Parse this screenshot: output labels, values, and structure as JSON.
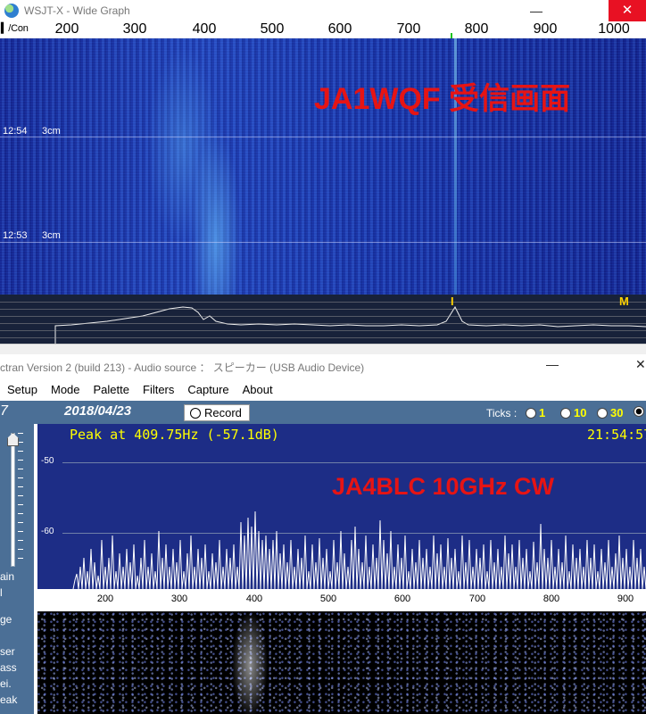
{
  "wsjt": {
    "title": "WSJT-X - Wide Graph",
    "control_label": "Con",
    "scale_ticks": [
      "200",
      "300",
      "400",
      "500",
      "600",
      "700",
      "800",
      "900",
      "1000"
    ],
    "time_stamps": [
      {
        "time": "12:54",
        "value": "3cm"
      },
      {
        "time": "12:53",
        "value": "3cm"
      }
    ],
    "overlay": "JA1WQF 受信画面",
    "spectrum_markers": [
      "I",
      "M"
    ]
  },
  "spectran": {
    "title": "ctran Version 2  (build 213) - Audio source ： スピーカー (USB Audio Device)",
    "menu": [
      "Setup",
      "Mode",
      "Palette",
      "Filters",
      "Capture",
      "About"
    ],
    "counter": "7",
    "date": "2018/04/23",
    "record_label": "Record",
    "ticks_label": "Ticks :",
    "tick_options": [
      {
        "label": "1",
        "selected": false
      },
      {
        "label": "10",
        "selected": false
      },
      {
        "label": "30",
        "selected": false
      },
      {
        "label": "",
        "selected": true
      }
    ],
    "peak_text": "Peak at  409.75Hz (-57.1dB)",
    "clock": "21:54:57",
    "overlay": "JA4BLC  10GHz CW",
    "db_levels": [
      "-50",
      "-60"
    ],
    "freq_ticks": [
      "200",
      "300",
      "400",
      "500",
      "600",
      "700",
      "800",
      "900"
    ],
    "side_labels": [
      "ain",
      "l",
      "ge",
      "ser",
      "ass",
      "ei.",
      "eak"
    ]
  },
  "colors": {
    "wsjt_close": "#e81123",
    "spectran_panel": "#4b6f96",
    "spectrum_bg": "#1d2d86",
    "peak_text": "#ffff00",
    "overlay_red": "#e61414"
  }
}
